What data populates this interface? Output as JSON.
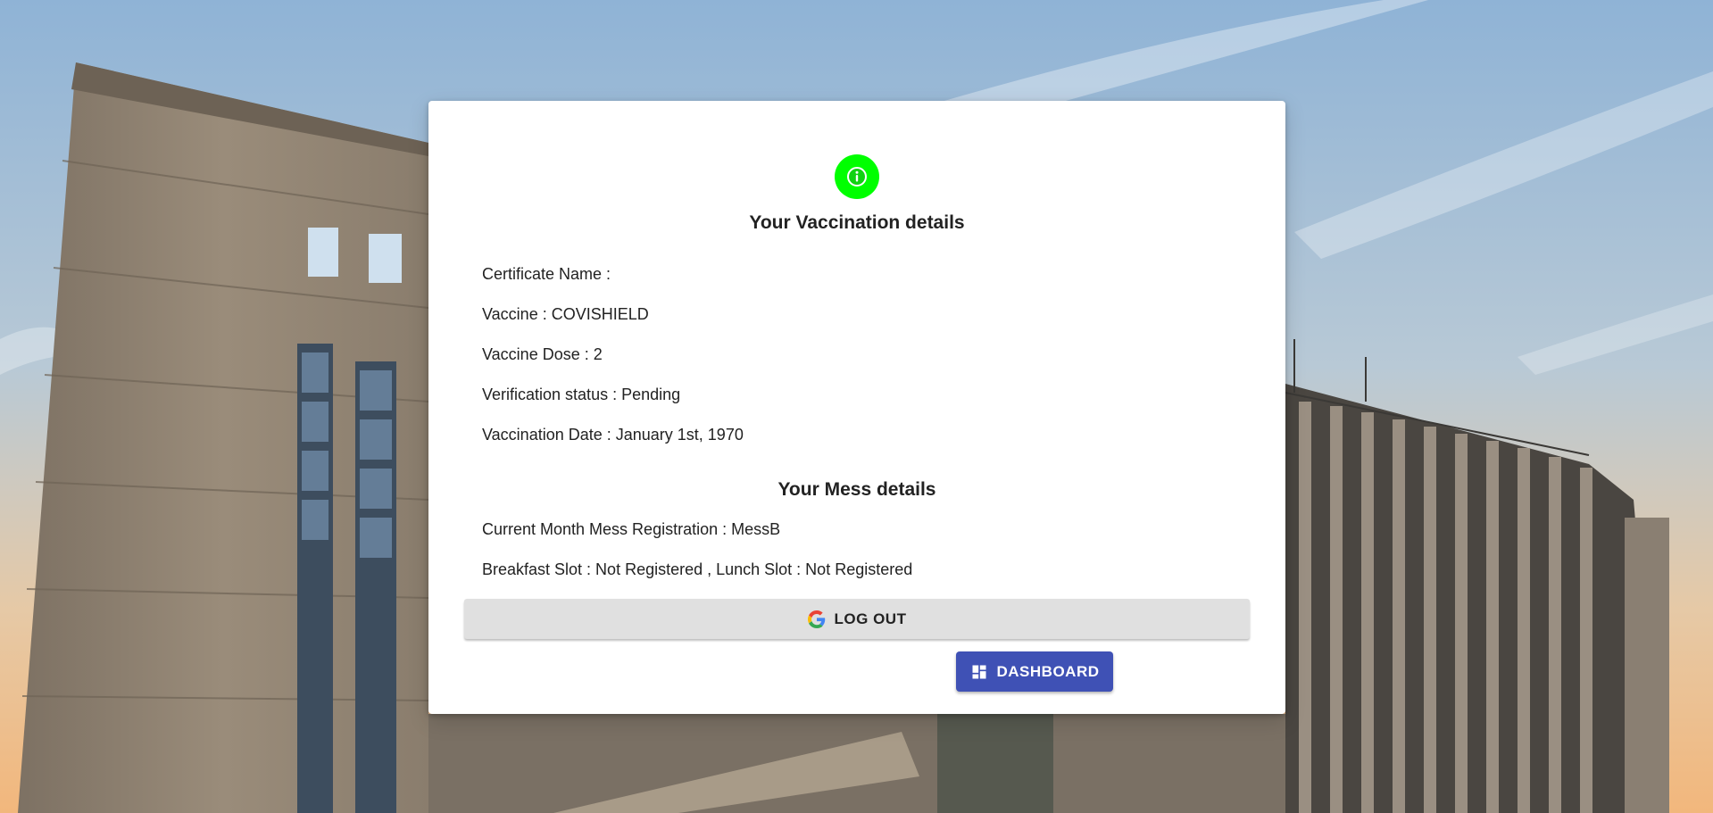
{
  "vaccination": {
    "title": "Your Vaccination details",
    "certificate_name": "Certificate Name :",
    "vaccine": "Vaccine : COVISHIELD",
    "dose": "Vaccine Dose : 2",
    "verification": "Verification status : Pending",
    "date": "Vaccination Date : January 1st, 1970"
  },
  "mess": {
    "title": "Your Mess details",
    "registration": "Current Month Mess Registration : MessB",
    "slots": "Breakfast Slot : Not Registered , Lunch Slot : Not Registered"
  },
  "buttons": {
    "logout_label": "LOG OUT",
    "dashboard_label": "DASHBOARD"
  },
  "icons": {
    "status": "info-icon",
    "logout": "google-icon",
    "dashboard": "dashboard-icon"
  },
  "colors": {
    "info_badge": "#00ff00",
    "dashboard_button": "#3f51b5",
    "logout_button": "#e0e0e0"
  }
}
